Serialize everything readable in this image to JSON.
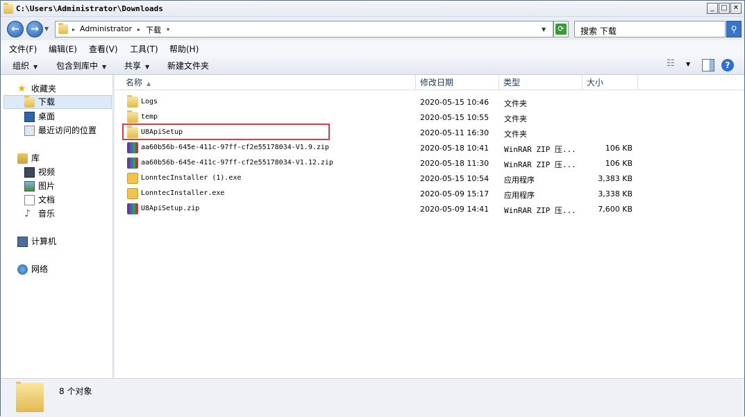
{
  "window": {
    "title": "C:\\Users\\Administrator\\Downloads"
  },
  "address": {
    "segments": [
      "Administrator",
      "下载"
    ],
    "search_placeholder": "搜索 下载"
  },
  "menu": {
    "items": [
      "文件(F)",
      "编辑(E)",
      "查看(V)",
      "工具(T)",
      "帮助(H)"
    ]
  },
  "commands": {
    "organize": "组织",
    "include_in_library": "包含到库中",
    "share": "共享",
    "new_folder": "新建文件夹"
  },
  "nav": {
    "favorites": "收藏夹",
    "downloads": "下载",
    "desktop": "桌面",
    "recent": "最近访问的位置",
    "libraries": "库",
    "videos": "视频",
    "pictures": "图片",
    "documents": "文档",
    "music": "音乐",
    "computer": "计算机",
    "network": "网络"
  },
  "columns": {
    "name": "名称",
    "modified": "修改日期",
    "type": "类型",
    "size": "大小"
  },
  "files": [
    {
      "name": "Logs",
      "modified": "2020-05-15 10:46",
      "type": "文件夹",
      "size": "",
      "icon": "folder-icon"
    },
    {
      "name": "temp",
      "modified": "2020-05-15 10:55",
      "type": "文件夹",
      "size": "",
      "icon": "folder-icon"
    },
    {
      "name": "U8ApiSetup",
      "modified": "2020-05-11 16:30",
      "type": "文件夹",
      "size": "",
      "icon": "folder-icon"
    },
    {
      "name": "aa60b56b-645e-411c-97ff-cf2e55178034-V1.9.zip",
      "modified": "2020-05-18 10:41",
      "type": "WinRAR ZIP 压...",
      "size": "106 KB",
      "icon": "winrar-icon"
    },
    {
      "name": "aa60b56b-645e-411c-97ff-cf2e55178034-V1.12.zip",
      "modified": "2020-05-18 11:30",
      "type": "WinRAR ZIP 压...",
      "size": "106 KB",
      "icon": "winrar-icon"
    },
    {
      "name": "LonntecInstaller (1).exe",
      "modified": "2020-05-15 10:54",
      "type": "应用程序",
      "size": "3,383 KB",
      "icon": "exe-icon"
    },
    {
      "name": "LonntecInstaller.exe",
      "modified": "2020-05-09 15:17",
      "type": "应用程序",
      "size": "3,338 KB",
      "icon": "exe-icon"
    },
    {
      "name": "U8ApiSetup.zip",
      "modified": "2020-05-09 14:41",
      "type": "WinRAR ZIP 压...",
      "size": "7,600 KB",
      "icon": "winrar-icon"
    }
  ],
  "status": {
    "count_text": "8 个对象"
  }
}
